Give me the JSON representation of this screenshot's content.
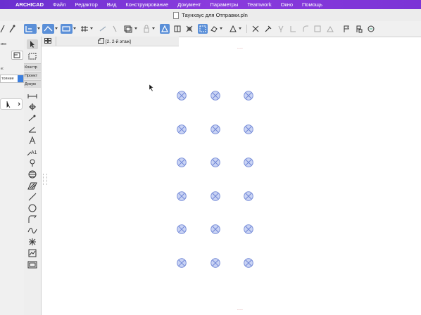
{
  "menubar": {
    "app_name": "ARCHICAD",
    "items": [
      "Файл",
      "Редактор",
      "Вид",
      "Конструирование",
      "Документ",
      "Параметры",
      "Teamwork",
      "Окно",
      "Помощь"
    ]
  },
  "window": {
    "title": "Таунхаус для Отправки.pln"
  },
  "tab": {
    "label": "[2. 2-й этаж]"
  },
  "left_panel": {
    "label_top": "ию:",
    "label_mid": "е:",
    "dropdown_value": "тояние",
    "toolbox_groups": [
      "Констр",
      "Проект",
      "Докум"
    ]
  },
  "toolbox_tools": [
    "arrow-select",
    "marquee",
    "dimension",
    "level-dimension",
    "radial-dimension",
    "angle-dimension",
    "text",
    "label",
    "section-marker",
    "zone",
    "fill",
    "line",
    "circle",
    "polyline",
    "spline",
    "hotspot",
    "figure",
    "drawing"
  ],
  "canvas": {
    "column_rows": 6,
    "column_cols": 3,
    "column_color": "#6f86d6",
    "column_fill": "#c9d3f4"
  },
  "colors": {
    "menubar": "#7b34d6",
    "toolbar_active": "#5a8fd8"
  }
}
